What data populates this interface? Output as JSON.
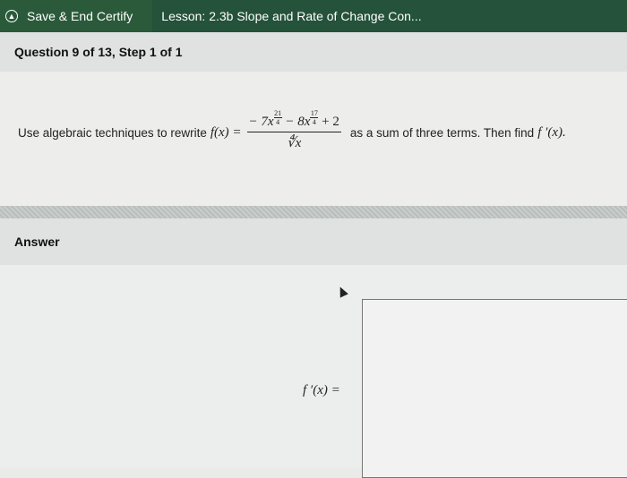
{
  "topbar": {
    "save_label": "Save & End Certify",
    "lesson_title": "Lesson: 2.3b Slope and Rate of Change Con..."
  },
  "question": {
    "header": "Question 9 of 13, Step 1 of 1",
    "prompt_start": "Use algebraic techniques to rewrite",
    "func_lhs": "f(x) =",
    "numerator_term1": "− 7x",
    "exp1_num": "21",
    "exp1_den": "4",
    "numerator_term2": " − 8x",
    "exp2_num": "17",
    "exp2_den": "4",
    "numerator_term3": " + 2",
    "denominator": "∜x",
    "prompt_end": "as a sum of three terms. Then find",
    "find_expr": "f ′(x)."
  },
  "answer": {
    "header": "Answer",
    "label": "f ′(x) ="
  }
}
